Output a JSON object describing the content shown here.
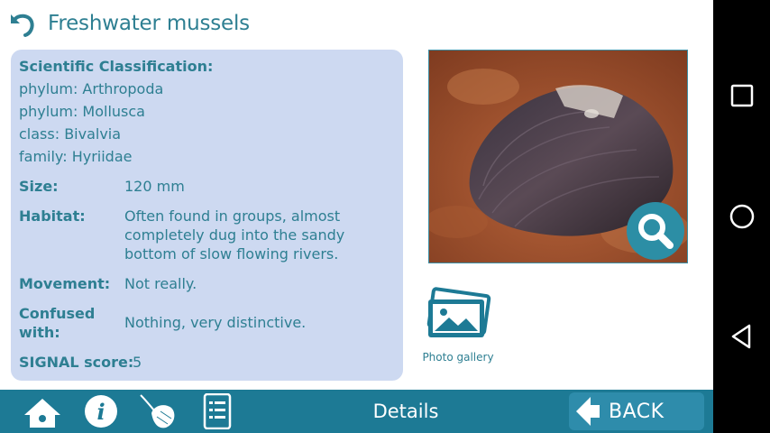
{
  "header": {
    "title": "Freshwater mussels"
  },
  "classification": {
    "heading": "Scientific Classification:",
    "lines": [
      "phylum: Arthropoda",
      "phylum: Mollusca",
      "class: Bivalvia",
      "family: Hyriidae"
    ]
  },
  "details": {
    "size_label": "Size:",
    "size_value": "120 mm",
    "habitat_label": "Habitat:",
    "habitat_value": "Often found in groups, almost completely dug into the sandy bottom of slow flowing rivers.",
    "movement_label": "Movement:",
    "movement_value": "Not really.",
    "confused_label": "Confused with:",
    "confused_value": "Nothing, very distinctive.",
    "signal_label": "SIGNAL score:",
    "signal_value": "5"
  },
  "gallery": {
    "label": "Photo gallery"
  },
  "bottom_bar": {
    "tab_label": "Details",
    "back_label": "BACK"
  },
  "icons": {
    "back": "undo-arrow-icon",
    "zoom": "magnifier-icon",
    "gallery": "photos-icon",
    "home": "home-icon",
    "info": "info-icon",
    "feather": "feather-icon",
    "list": "list-icon"
  },
  "colors": {
    "accent": "#2e7f92",
    "panel": "#cdd9f1",
    "bar": "#1d7a95",
    "button": "#2e8cab"
  }
}
